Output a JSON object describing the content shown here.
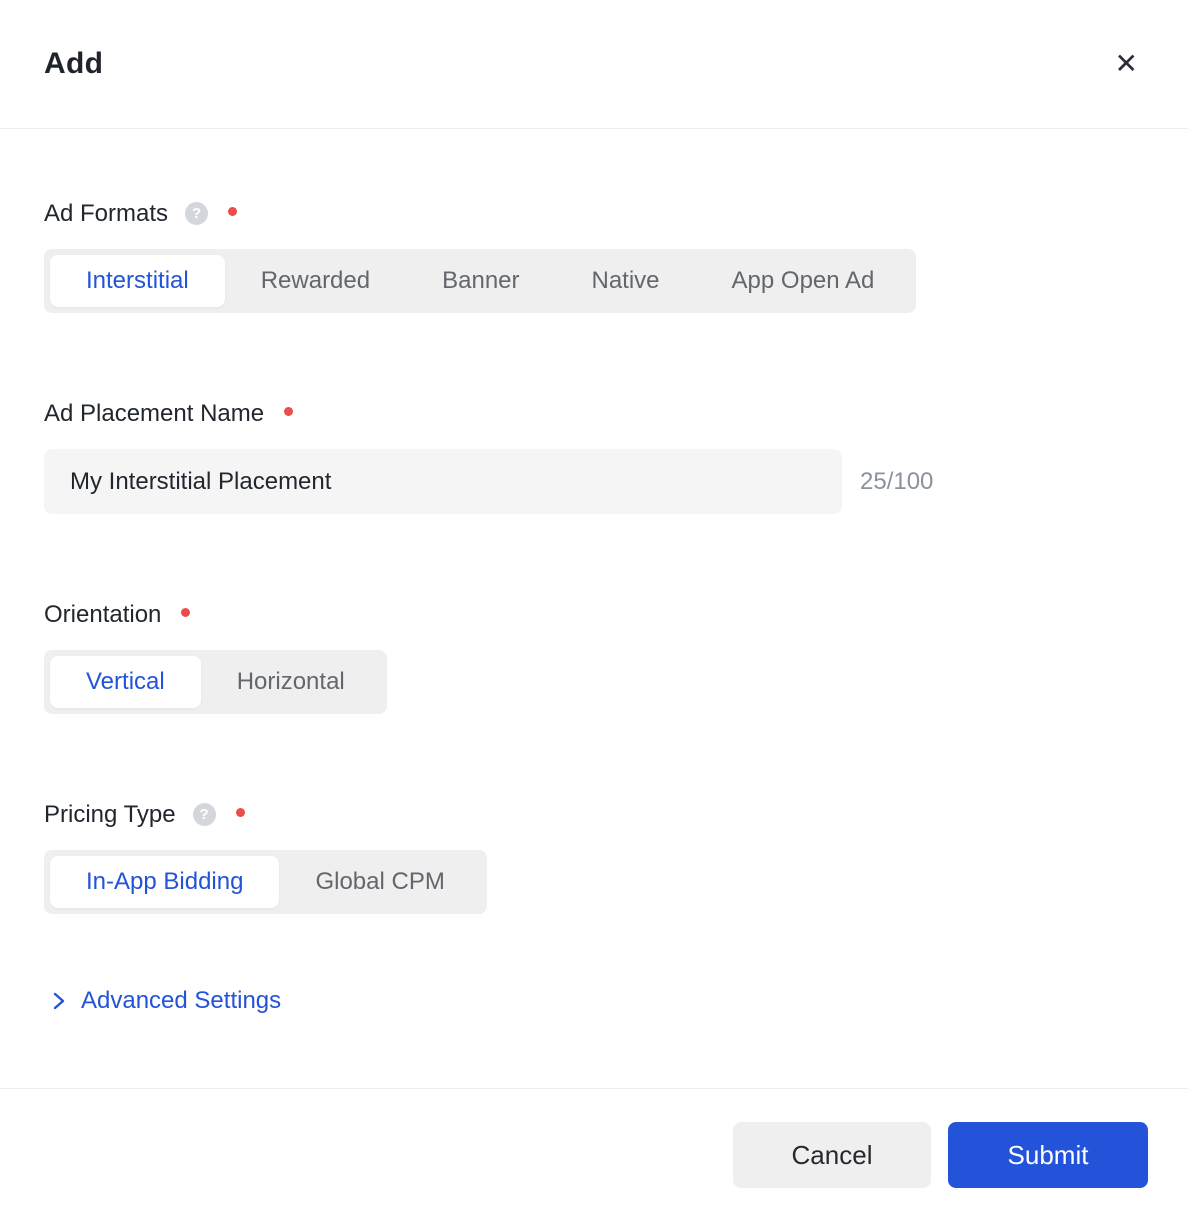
{
  "header": {
    "title": "Add",
    "close_icon": "✕"
  },
  "ad_formats": {
    "label": "Ad Formats",
    "help_icon": "?",
    "required": true,
    "options": [
      "Interstitial",
      "Rewarded",
      "Banner",
      "Native",
      "App Open Ad"
    ],
    "selected": "Interstitial"
  },
  "ad_placement_name": {
    "label": "Ad Placement Name",
    "required": true,
    "value": "My Interstitial Placement",
    "counter": "25/100"
  },
  "orientation": {
    "label": "Orientation",
    "required": true,
    "options": [
      "Vertical",
      "Horizontal"
    ],
    "selected": "Vertical"
  },
  "pricing_type": {
    "label": "Pricing Type",
    "help_icon": "?",
    "required": true,
    "options": [
      "In-App Bidding",
      "Global CPM"
    ],
    "selected": "In-App Bidding"
  },
  "advanced_settings": {
    "label": "Advanced Settings",
    "chevron_icon": "chevron-right"
  },
  "footer": {
    "cancel_label": "Cancel",
    "submit_label": "Submit"
  },
  "colors": {
    "accent_blue": "#2353d9",
    "required_red": "#ea4d49",
    "control_bg": "#efefef",
    "input_bg": "#f5f5f5"
  }
}
